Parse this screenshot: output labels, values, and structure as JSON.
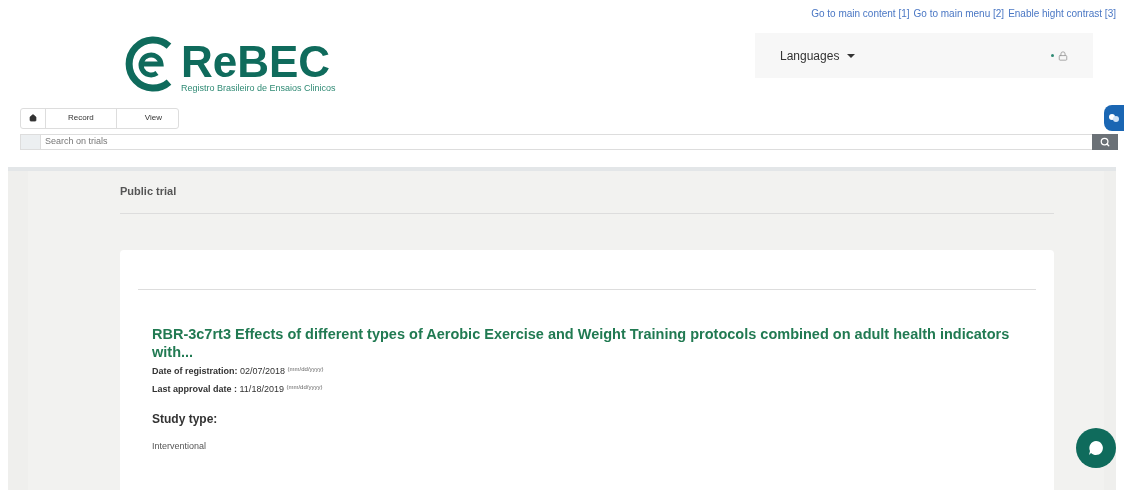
{
  "skip_links": [
    "Go to main content [1]",
    "Go to main menu [2]",
    "Enable hight contrast [3]"
  ],
  "logo": {
    "name": "ReBEC",
    "subtitle": "Registro Brasileiro de Ensaios Clinicos"
  },
  "languages": {
    "label": "Languages"
  },
  "breadcrumb": [
    "Record",
    "View"
  ],
  "search": {
    "placeholder": "Search on trials"
  },
  "page_title": "Public trial",
  "trial": {
    "title": "RBR-3c7rt3 Effects of different types of Aerobic Exercise and Weight Training protocols combined on adult health indicators with...",
    "dates": [
      "**Date of registration:** 02/07/2018 $^{(mm/dd/yyyy)}$",
      "**Last approval date :** 11/18/2019 $^{(mm/dd/yyyy)}$"
    ],
    "section_title": "Study type:",
    "study_type": "Interventional"
  }
}
